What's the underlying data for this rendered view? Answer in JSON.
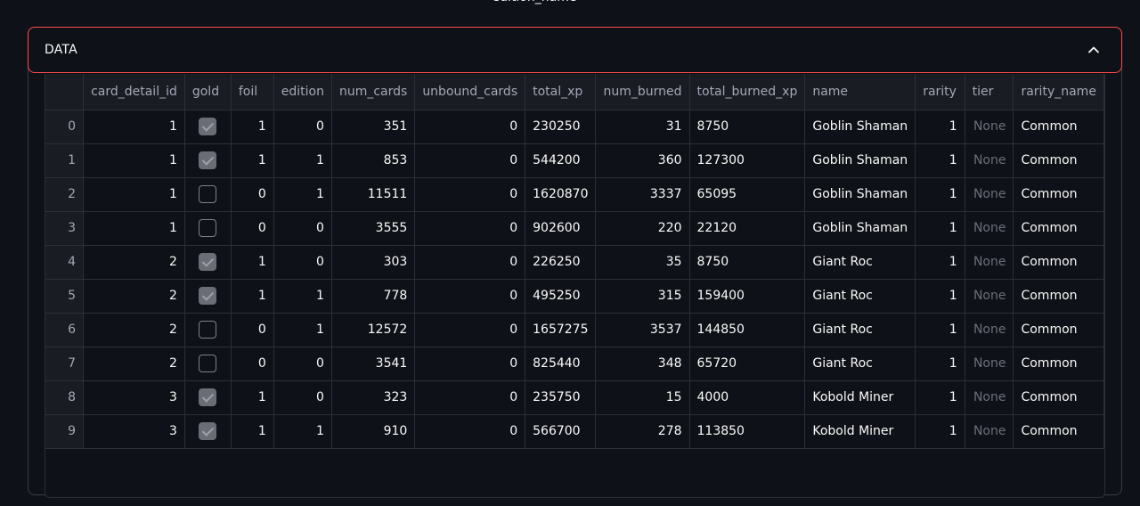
{
  "top_label": "edition_name",
  "expander": {
    "title": "DATA"
  },
  "table": {
    "columns": [
      "",
      "card_detail_id",
      "gold",
      "foil",
      "edition",
      "num_cards",
      "unbound_cards",
      "total_xp",
      "num_burned",
      "total_burned_xp",
      "name",
      "rarity",
      "tier",
      "rarity_name"
    ],
    "rows": [
      [
        "0",
        "1",
        true,
        "1",
        "0",
        "351",
        "0",
        "230250",
        "31",
        "8750",
        "Goblin Shaman",
        "1",
        "None",
        "Common"
      ],
      [
        "1",
        "1",
        true,
        "1",
        "1",
        "853",
        "0",
        "544200",
        "360",
        "127300",
        "Goblin Shaman",
        "1",
        "None",
        "Common"
      ],
      [
        "2",
        "1",
        false,
        "0",
        "1",
        "11511",
        "0",
        "1620870",
        "3337",
        "65095",
        "Goblin Shaman",
        "1",
        "None",
        "Common"
      ],
      [
        "3",
        "1",
        false,
        "0",
        "0",
        "3555",
        "0",
        "902600",
        "220",
        "22120",
        "Goblin Shaman",
        "1",
        "None",
        "Common"
      ],
      [
        "4",
        "2",
        true,
        "1",
        "0",
        "303",
        "0",
        "226250",
        "35",
        "8750",
        "Giant Roc",
        "1",
        "None",
        "Common"
      ],
      [
        "5",
        "2",
        true,
        "1",
        "1",
        "778",
        "0",
        "495250",
        "315",
        "159400",
        "Giant Roc",
        "1",
        "None",
        "Common"
      ],
      [
        "6",
        "2",
        false,
        "0",
        "1",
        "12572",
        "0",
        "1657275",
        "3537",
        "144850",
        "Giant Roc",
        "1",
        "None",
        "Common"
      ],
      [
        "7",
        "2",
        false,
        "0",
        "0",
        "3541",
        "0",
        "825440",
        "348",
        "65720",
        "Giant Roc",
        "1",
        "None",
        "Common"
      ],
      [
        "8",
        "3",
        true,
        "1",
        "0",
        "323",
        "0",
        "235750",
        "15",
        "4000",
        "Kobold Miner",
        "1",
        "None",
        "Common"
      ],
      [
        "9",
        "3",
        true,
        "1",
        "1",
        "910",
        "0",
        "566700",
        "278",
        "113850",
        "Kobold Miner",
        "1",
        "None",
        "Common"
      ]
    ]
  },
  "colors": {
    "accent": "#ff4b4b",
    "background": "#0e1117",
    "header_bg": "#1a1c24",
    "grid": "#2c2f38"
  }
}
